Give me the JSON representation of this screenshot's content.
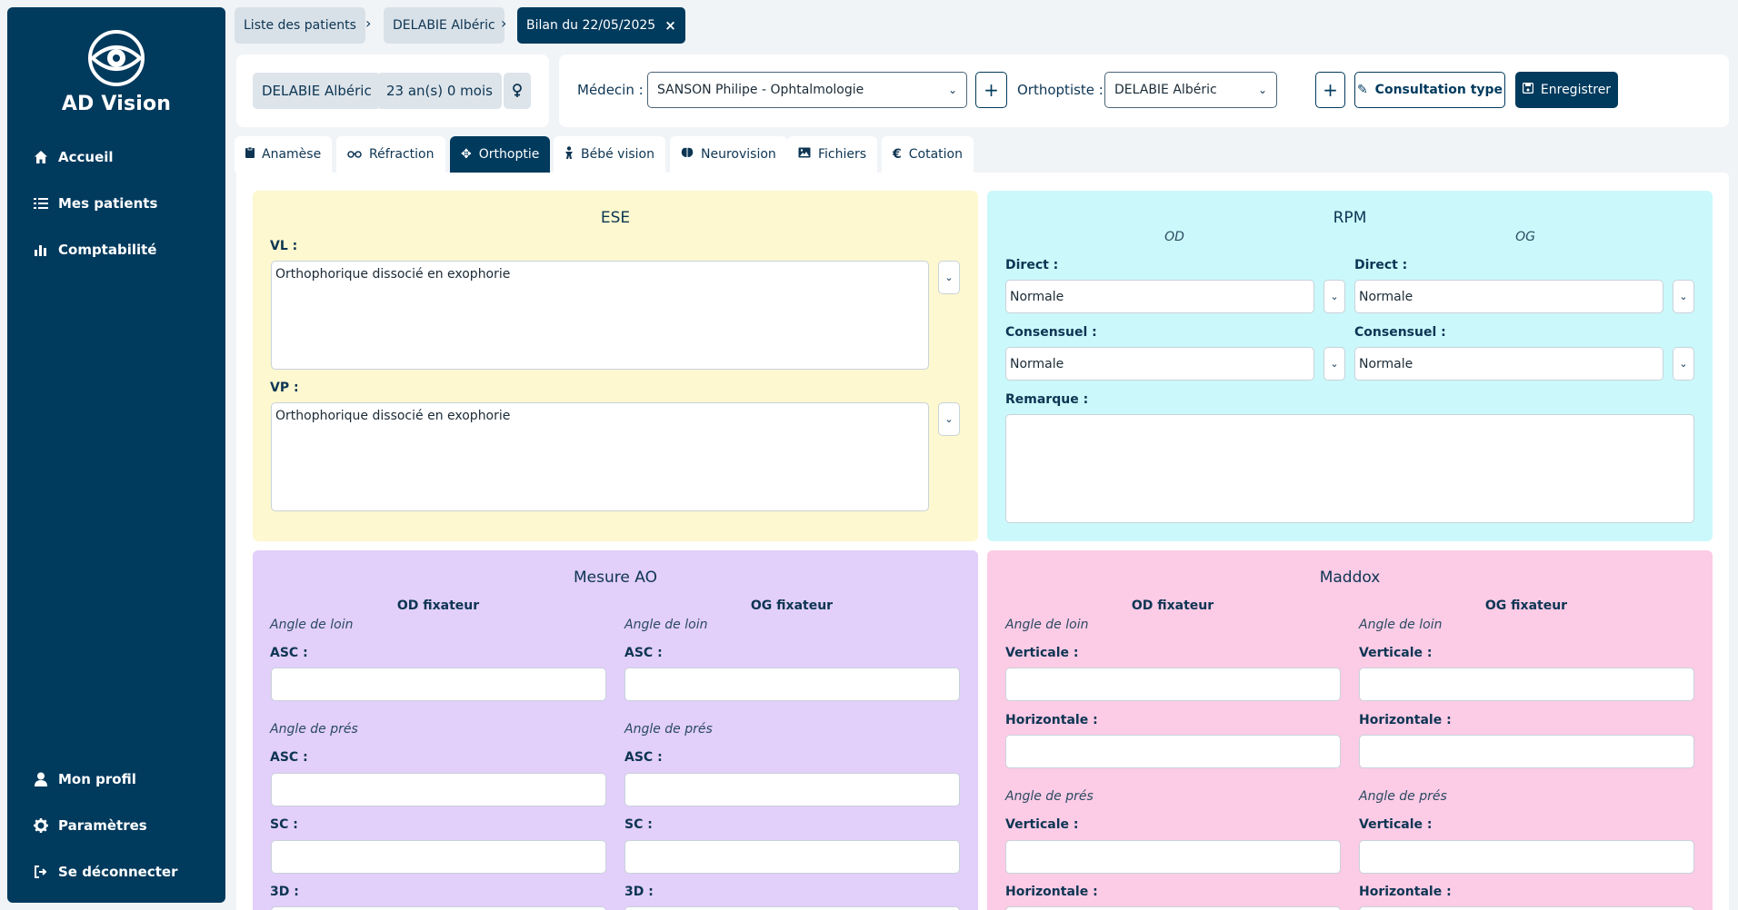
{
  "app": {
    "name": "AD Vision"
  },
  "sidebar": {
    "items": [
      {
        "label": "Accueil",
        "icon": "home-icon"
      },
      {
        "label": "Mes patients",
        "icon": "list-icon"
      },
      {
        "label": "Comptabilité",
        "icon": "chart-icon"
      }
    ],
    "bottom": [
      {
        "label": "Mon profil",
        "icon": "user-icon"
      },
      {
        "label": "Paramètres",
        "icon": "gear-icon"
      },
      {
        "label": "Se déconnecter",
        "icon": "logout-icon"
      }
    ]
  },
  "breadcrumb": {
    "items": [
      "Liste des patients",
      "DELABIE Albéric",
      "Bilan du 22/05/2025"
    ]
  },
  "patient": {
    "name": "DELABIE Albéric",
    "age": "23 an(s) 0 mois",
    "sex_icon": "female-icon"
  },
  "header": {
    "medecin_label": "Médecin :",
    "medecin_value": "SANSON Philipe - Ophtalmologie",
    "orthoptiste_label": "Orthoptiste :",
    "orthoptiste_value": "DELABIE Albéric",
    "consultation_label": "Consultation type",
    "save_label": "Enregistrer"
  },
  "tabs": [
    {
      "label": "Anamèse",
      "icon": "clipboard-icon"
    },
    {
      "label": "Réfraction",
      "icon": "glasses-icon"
    },
    {
      "label": "Orthoptie",
      "icon": "move-icon"
    },
    {
      "label": "Bébé vision",
      "icon": "baby-icon"
    },
    {
      "label": "Neurovision",
      "icon": "brain-icon"
    },
    {
      "label": "Fichiers",
      "icon": "image-icon"
    },
    {
      "label": "Cotation",
      "icon": "euro-icon"
    }
  ],
  "ese": {
    "title": "ESE",
    "vl_label": "VL :",
    "vl_value": "Orthophorique dissocié en exophorie",
    "vp_label": "VP :",
    "vp_value": "Orthophorique dissocié en exophorie"
  },
  "rpm": {
    "title": "RPM",
    "od": "OD",
    "og": "OG",
    "direct_label": "Direct :",
    "consensuel_label": "Consensuel :",
    "od_direct": "Normale",
    "od_consensuel": "Normale",
    "og_direct": "Normale",
    "og_consensuel": "Normale",
    "remarque_label": "Remarque :",
    "remarque_value": ""
  },
  "mesure_ao": {
    "title": "Mesure AO",
    "od_fix": "OD fixateur",
    "og_fix": "OG fixateur",
    "angle_loin": "Angle de loin",
    "angle_pres": "Angle de prés",
    "asc": "ASC :",
    "sc": "SC :",
    "d3": "3D :"
  },
  "maddox": {
    "title": "Maddox",
    "od_fix": "OD fixateur",
    "og_fix": "OG fixateur",
    "angle_loin": "Angle de loin",
    "angle_pres": "Angle de prés",
    "verticale": "Verticale :",
    "horizontale": "Horizontale :"
  },
  "colors": {
    "sidebar": "#003a5d",
    "ese_bg": "#fdf8cf",
    "rpm_bg": "#cbf8fb",
    "ao_bg": "#e2cffa",
    "maddox_bg": "#fccbe6"
  }
}
